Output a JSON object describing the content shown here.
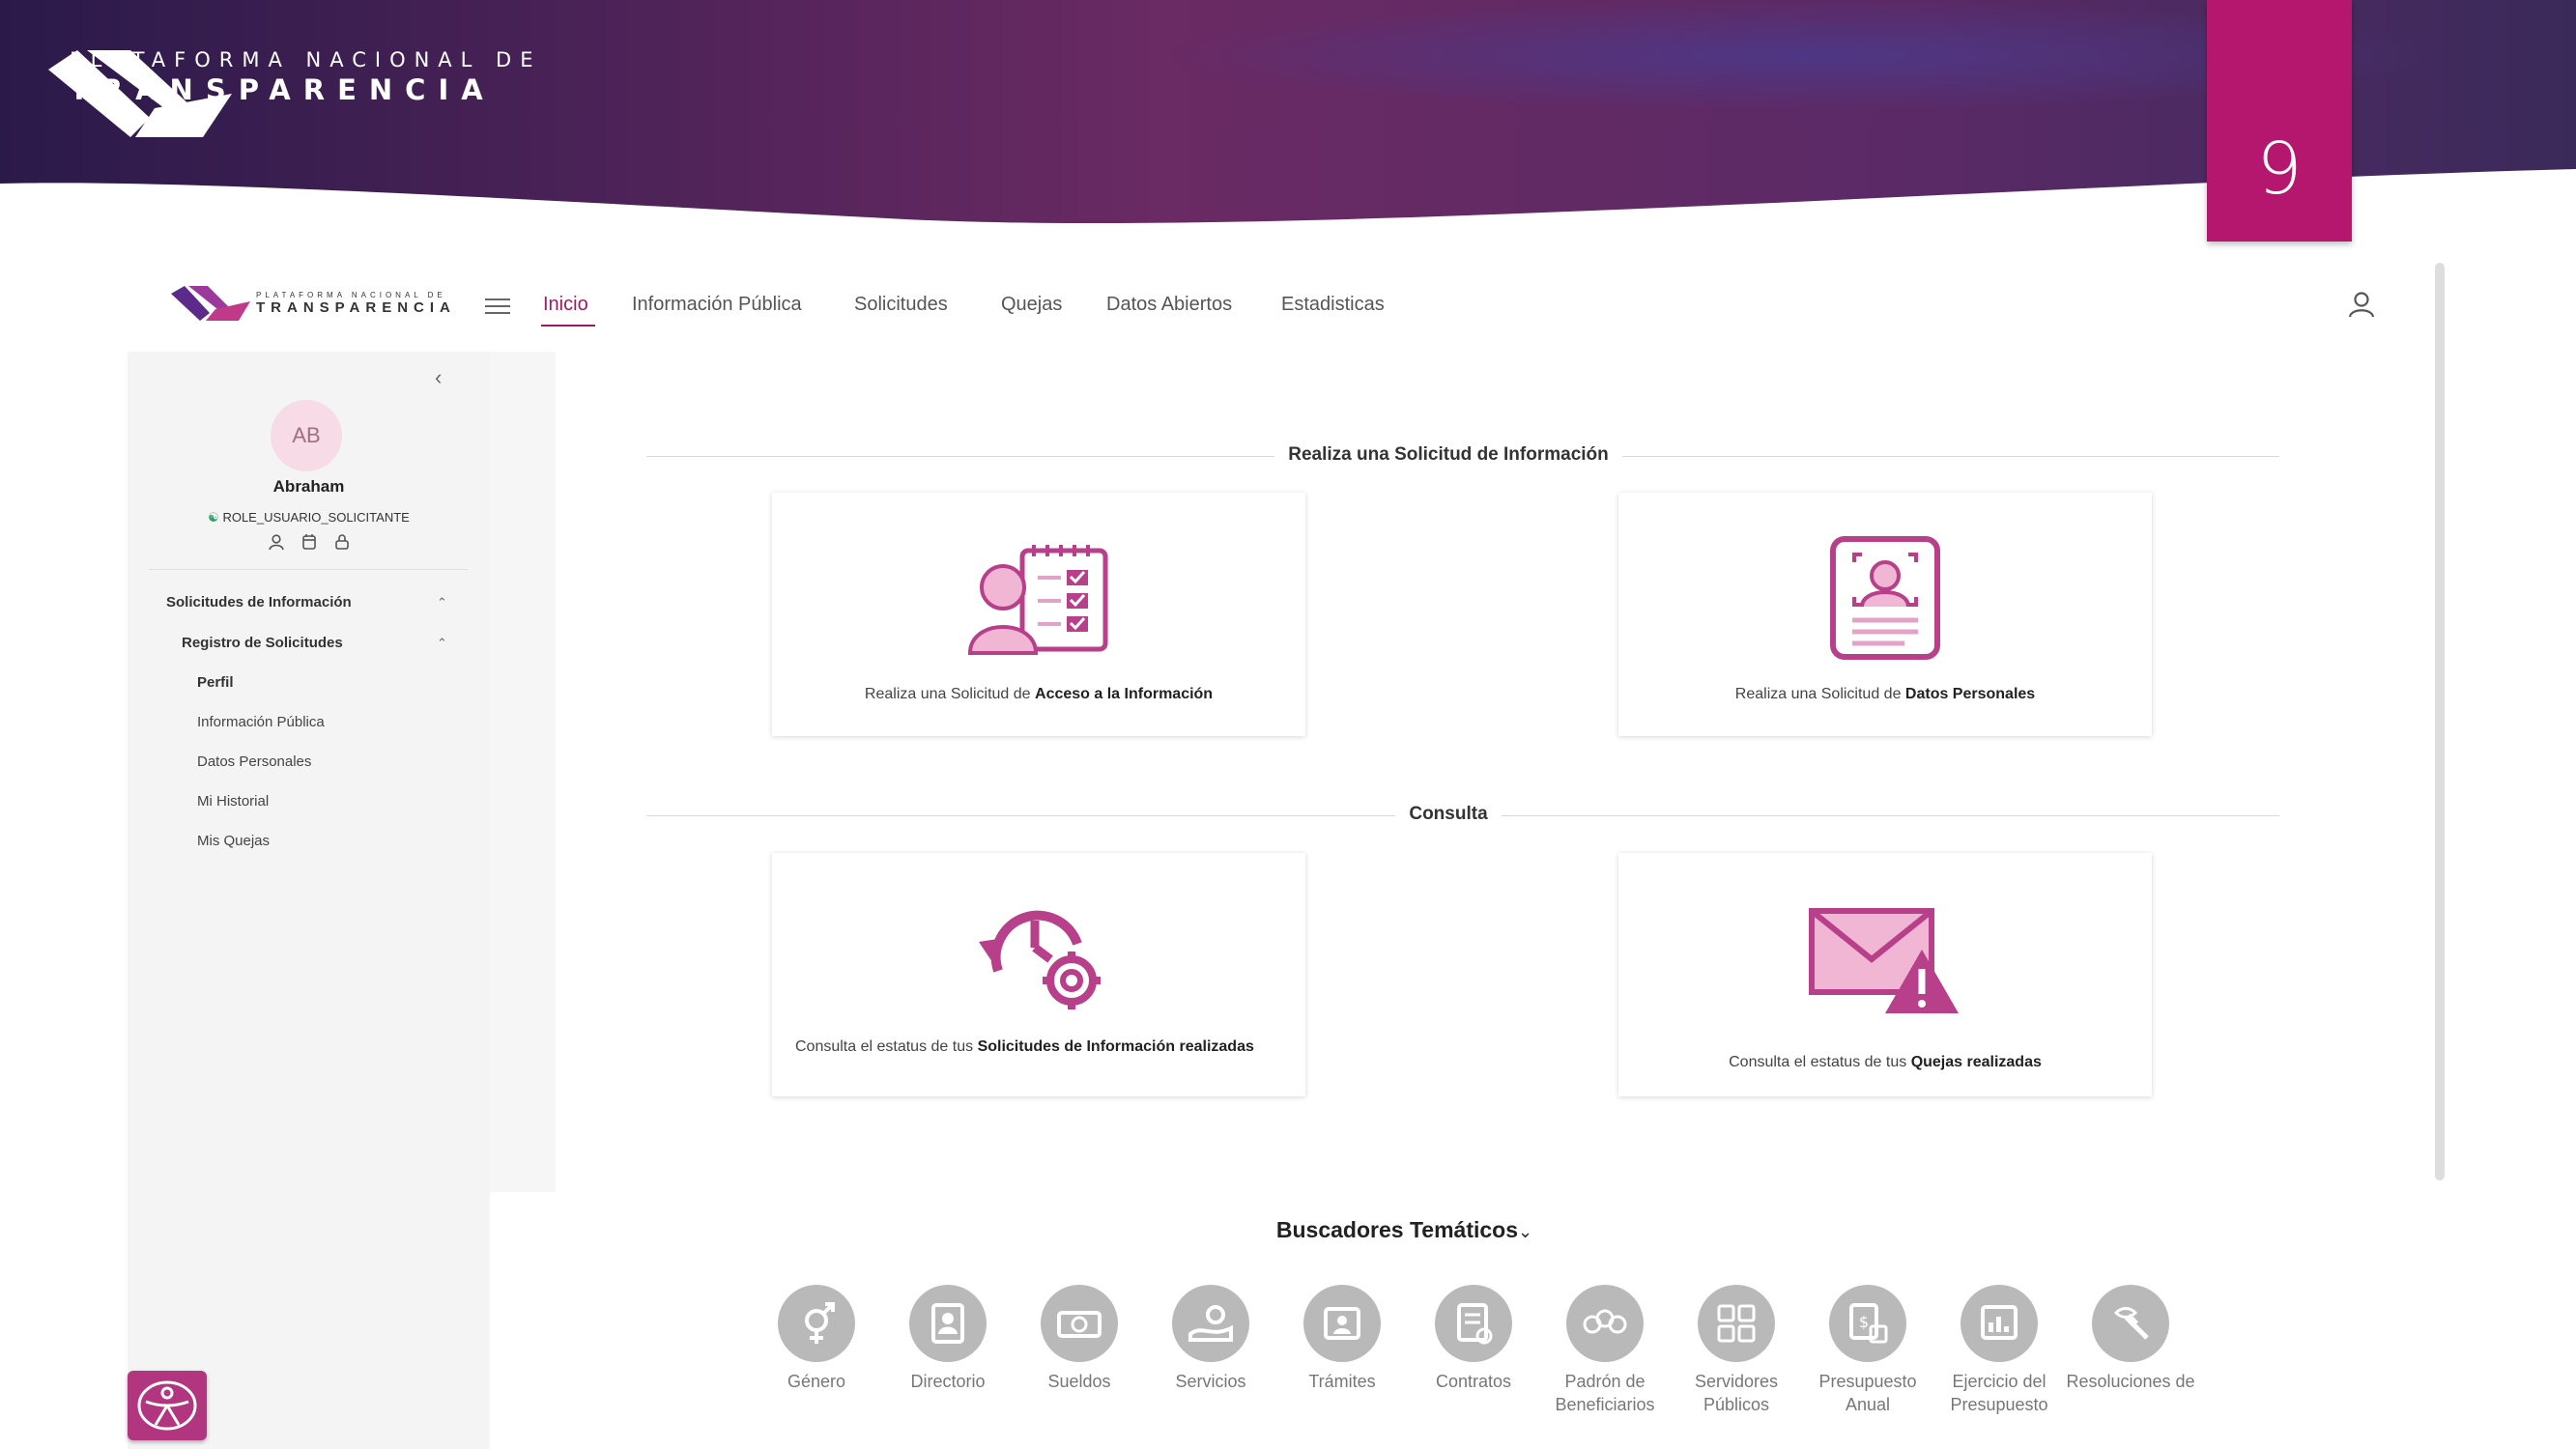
{
  "slide": {
    "brand_line1": "PLATAFORMA NACIONAL DE",
    "brand_line2": "TRANSPARENCIA",
    "page_number": "9"
  },
  "colors": {
    "accent": "#9b1c63",
    "badge": "#b5176e",
    "banner_start": "#2a1a4a",
    "banner_end": "#7a2a64",
    "icon_pink": "#b83f8a"
  },
  "app": {
    "logo_line1": "PLATAFORMA NACIONAL DE",
    "logo_line2": "TRANSPARENCIA",
    "nav": [
      {
        "label": "Inicio",
        "active": true
      },
      {
        "label": "Información Pública"
      },
      {
        "label": "Solicitudes"
      },
      {
        "label": "Quejas"
      },
      {
        "label": "Datos Abiertos"
      },
      {
        "label": "Estadisticas"
      }
    ],
    "user": {
      "initials": "AB",
      "name": "Abraham",
      "role": "ROLE_USUARIO_SOLICITANTE"
    },
    "sidebar": {
      "group": "Solicitudes de Información",
      "subgroup": "Registro de Solicitudes",
      "items": [
        "Perfil",
        "Información Pública",
        "Datos Personales",
        "Mi Historial",
        "Mis Quejas"
      ]
    },
    "sections": {
      "request_title": "Realiza una Solicitud de Información",
      "consult_title": "Consulta"
    },
    "cards": {
      "acceso": {
        "prefix": "Realiza una Solicitud de ",
        "bold": "Acceso a la Información"
      },
      "datos": {
        "prefix": "Realiza una Solicitud de ",
        "bold": "Datos Personales"
      },
      "estatus_solicitudes": {
        "prefix": "Consulta el estatus de tus ",
        "bold": "Solicitudes de Información realizadas"
      },
      "estatus_quejas": {
        "prefix": "Consulta el estatus de tus ",
        "bold": "Quejas realizadas"
      }
    },
    "buscadores": {
      "title": "Buscadores Temáticos",
      "items": [
        {
          "label": "Género",
          "icon": "gender-icon"
        },
        {
          "label": "Directorio",
          "icon": "directory-icon"
        },
        {
          "label": "Sueldos",
          "icon": "salary-icon"
        },
        {
          "label": "Servicios",
          "icon": "services-icon"
        },
        {
          "label": "Trámites",
          "icon": "procedures-icon"
        },
        {
          "label": "Contratos",
          "icon": "contracts-icon"
        },
        {
          "label": "Padrón de Beneficiarios",
          "icon": "beneficiaries-icon"
        },
        {
          "label": "Servidores Públicos",
          "icon": "public-servants-icon"
        },
        {
          "label": "Presupuesto Anual",
          "icon": "budget-icon"
        },
        {
          "label": "Ejercicio del Presupuesto",
          "icon": "budget-exercise-icon"
        },
        {
          "label": "Resoluciones de",
          "icon": "resolutions-icon"
        }
      ]
    }
  }
}
